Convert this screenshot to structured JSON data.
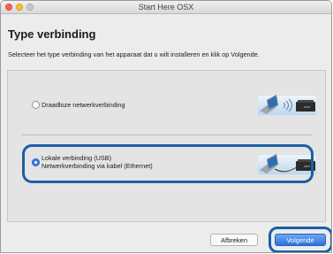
{
  "window": {
    "title": "Start Here OSX"
  },
  "header": {
    "title": "Type verbinding",
    "subtitle": "Selecteer het type verbinding van het apparaat dat u wilt installeren en klik op Volgende."
  },
  "options": [
    {
      "label_line1": "Draadloze netwerkverbinding",
      "label_line2": "",
      "selected": false
    },
    {
      "label_line1": "Lokale verbinding (USB)",
      "label_line2": "Netwerkverbinding via kabel (Ethernet)",
      "selected": true
    }
  ],
  "buttons": {
    "cancel_label": "Afbreken",
    "next_label": "Volgende"
  },
  "colors": {
    "accent": "#1c5fa4",
    "primary_button": "#2d74dc"
  },
  "icons": [
    "close-button-icon",
    "minimize-button-icon",
    "zoom-button-icon",
    "laptop-wifi-printer-icon",
    "laptop-cable-printer-icon"
  ]
}
